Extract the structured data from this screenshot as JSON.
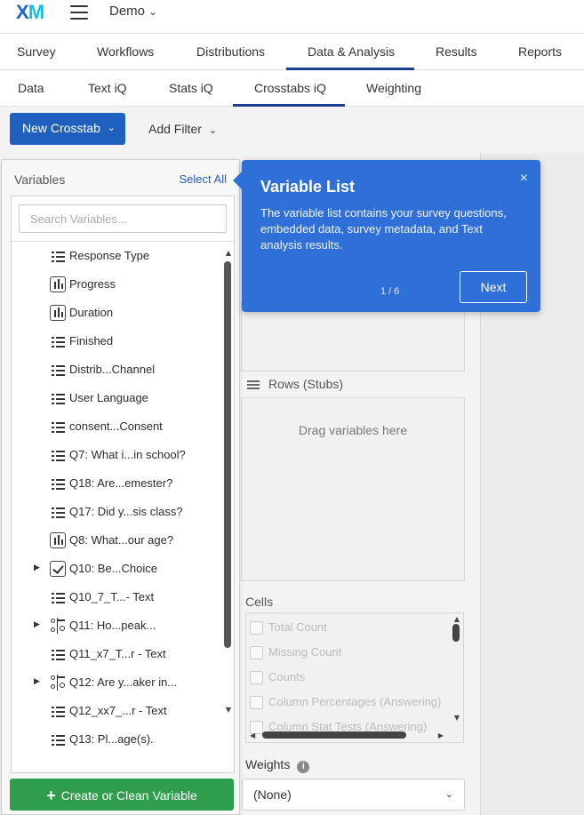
{
  "header": {
    "logo": "XM",
    "project_name": "Demo"
  },
  "main_tabs": [
    "Survey",
    "Workflows",
    "Distributions",
    "Data & Analysis",
    "Results",
    "Reports"
  ],
  "sub_tabs": [
    "Data",
    "Text iQ",
    "Stats iQ",
    "Crosstabs iQ",
    "Weighting"
  ],
  "active_main_tab": "Data & Analysis",
  "active_sub_tab": "Crosstabs iQ",
  "toolbar": {
    "new_crosstab": "New Crosstab",
    "add_filter": "Add Filter"
  },
  "variables": {
    "title": "Variables",
    "select_all": "Select All",
    "search_placeholder": "Search Variables...",
    "items": [
      {
        "label": "Response Type",
        "icon": "list-icon",
        "expandable": false
      },
      {
        "label": "Progress",
        "icon": "bar-chart-icon",
        "expandable": false
      },
      {
        "label": "Duration",
        "icon": "bar-chart-icon",
        "expandable": false
      },
      {
        "label": "Finished",
        "icon": "list-icon",
        "expandable": false
      },
      {
        "label": "Distrib...Channel",
        "icon": "list-icon",
        "expandable": false
      },
      {
        "label": "User Language",
        "icon": "list-icon",
        "expandable": false
      },
      {
        "label": "consent...Consent",
        "icon": "list-icon",
        "expandable": false
      },
      {
        "label": "Q7: What i...in school?",
        "icon": "list-icon",
        "expandable": false
      },
      {
        "label": "Q18: Are...emester?",
        "icon": "list-icon",
        "expandable": false
      },
      {
        "label": "Q17: Did y...sis class?",
        "icon": "list-icon",
        "expandable": false
      },
      {
        "label": "Q8: What...our age?",
        "icon": "bar-chart-icon",
        "expandable": false
      },
      {
        "label": "Q10: Be...Choice",
        "icon": "checkbox-icon",
        "expandable": true
      },
      {
        "label": "Q10_7_T...- Text",
        "icon": "list-icon",
        "expandable": false
      },
      {
        "label": "Q11: Ho...peak...",
        "icon": "matrix-icon",
        "expandable": true
      },
      {
        "label": "Q11_x7_T...r - Text",
        "icon": "list-icon",
        "expandable": false
      },
      {
        "label": "Q12: Are y...aker in...",
        "icon": "matrix-icon",
        "expandable": true
      },
      {
        "label": "Q12_xx7_...r - Text",
        "icon": "list-icon",
        "expandable": false
      },
      {
        "label": "Q13: Pl...age(s).",
        "icon": "list-icon",
        "expandable": false
      }
    ],
    "create_button": "Create or Clean Variable"
  },
  "tooltip": {
    "title": "Variable List",
    "body": "The variable list contains your survey questions, embedded data, survey metadata, and Text analysis results.",
    "counter": "1 / 6",
    "next": "Next",
    "close": "×"
  },
  "crosstab": {
    "rows_label": "Rows (Stubs)",
    "drag_hint": "Drag variables here",
    "cells_label": "Cells",
    "cells_options": [
      "Total Count",
      "Missing Count",
      "Counts",
      "Column Percentages (Answering)",
      "Column Stat Tests (Answering)"
    ],
    "weights_label": "Weights",
    "weights_value": "(None)"
  },
  "colors": {
    "brand_blue": "#1f5fbd",
    "tooltip_blue": "#2f6fd8",
    "create_green": "#2e9e4c"
  }
}
